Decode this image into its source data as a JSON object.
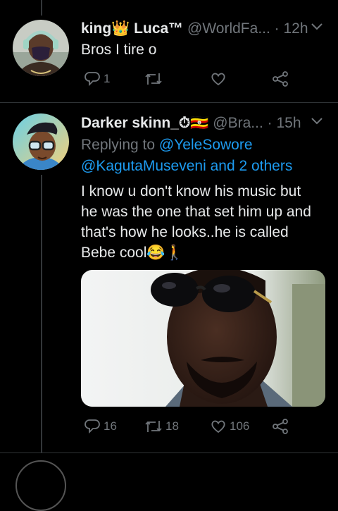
{
  "tweet1": {
    "name": "king",
    "name_suffix": " Luca™",
    "crown_emoji": "👑",
    "handle": "@WorldFa...",
    "time": "· 12h",
    "text": "Bros I tire o",
    "reply_count": "1",
    "retweet_count": "",
    "like_count": ""
  },
  "tweet2": {
    "name": "Darker skinn_",
    "name_emoji": "⏱🇺🇬",
    "handle": "@Bra...",
    "time": "· 15h",
    "replying_prefix": "Replying to ",
    "replying_to_1": "@YeleSowore",
    "replying_to_2": "@KagutaMuseveni and 2 others",
    "text_lines": [
      "I know u don't know his music but",
      "he was the one that set him up and",
      "that's how he looks..he is called",
      "Bebe cool"
    ],
    "text_emoji": "😂🚶",
    "reply_count": "16",
    "retweet_count": "18",
    "like_count": "106"
  },
  "colors": {
    "background": "#000000",
    "text": "#e7e9ea",
    "secondary": "#71767b",
    "accent": "#1d9bf0",
    "divider": "#2f3336"
  },
  "icons": [
    "chevron-down-icon",
    "reply-icon",
    "retweet-icon",
    "like-icon",
    "share-icon"
  ]
}
